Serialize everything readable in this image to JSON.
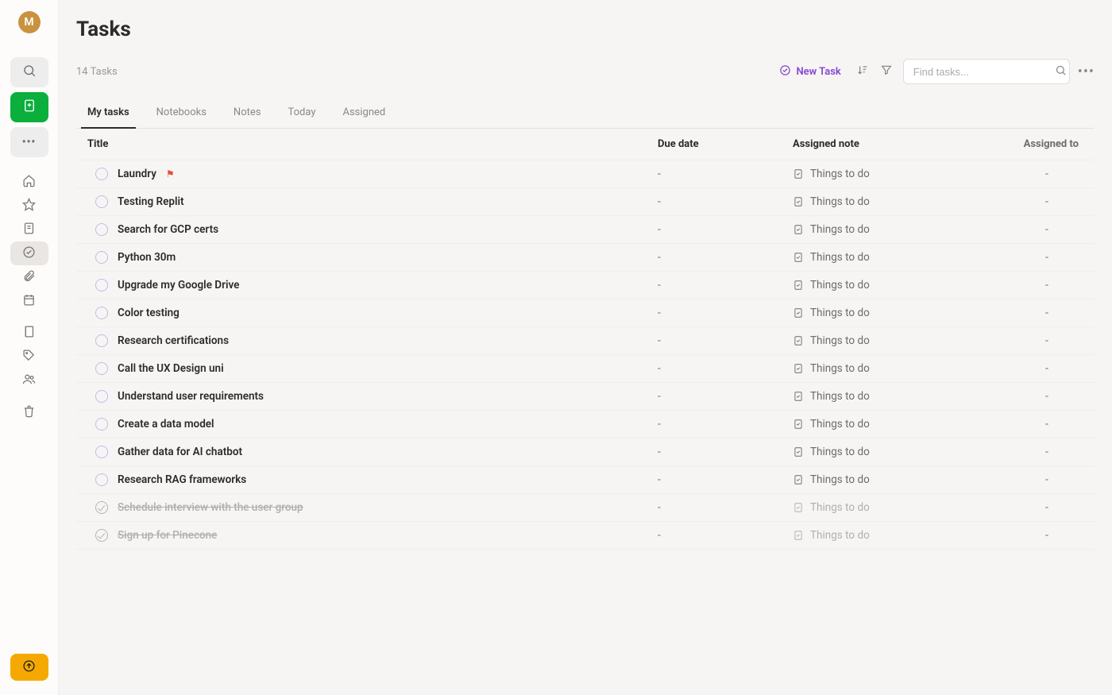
{
  "sidebar": {
    "avatar_letter": "M"
  },
  "header": {
    "title": "Tasks",
    "count_text": "14 Tasks",
    "new_task_label": "New Task",
    "search_placeholder": "Find tasks..."
  },
  "tabs": [
    {
      "id": "my-tasks",
      "label": "My tasks",
      "active": true
    },
    {
      "id": "notebooks",
      "label": "Notebooks",
      "active": false
    },
    {
      "id": "notes",
      "label": "Notes",
      "active": false
    },
    {
      "id": "today",
      "label": "Today",
      "active": false
    },
    {
      "id": "assigned",
      "label": "Assigned",
      "active": false
    }
  ],
  "columns": {
    "title": "Title",
    "due": "Due date",
    "note": "Assigned note",
    "assigned_to": "Assigned to"
  },
  "tasks": [
    {
      "title": "Laundry",
      "flagged": true,
      "due": "-",
      "note": "Things to do",
      "assigned": "-",
      "completed": false
    },
    {
      "title": "Testing Replit",
      "flagged": false,
      "due": "-",
      "note": "Things to do",
      "assigned": "-",
      "completed": false
    },
    {
      "title": "Search for GCP certs",
      "flagged": false,
      "due": "-",
      "note": "Things to do",
      "assigned": "-",
      "completed": false
    },
    {
      "title": "Python 30m",
      "flagged": false,
      "due": "-",
      "note": "Things to do",
      "assigned": "-",
      "completed": false
    },
    {
      "title": "Upgrade my Google Drive",
      "flagged": false,
      "due": "-",
      "note": "Things to do",
      "assigned": "-",
      "completed": false
    },
    {
      "title": "Color testing",
      "flagged": false,
      "due": "-",
      "note": "Things to do",
      "assigned": "-",
      "completed": false
    },
    {
      "title": "Research certifications",
      "flagged": false,
      "due": "-",
      "note": "Things to do",
      "assigned": "-",
      "completed": false
    },
    {
      "title": "Call the UX Design uni",
      "flagged": false,
      "due": "-",
      "note": "Things to do",
      "assigned": "-",
      "completed": false
    },
    {
      "title": "Understand user requirements",
      "flagged": false,
      "due": "-",
      "note": "Things to do",
      "assigned": "-",
      "completed": false
    },
    {
      "title": "Create a data model",
      "flagged": false,
      "due": "-",
      "note": "Things to do",
      "assigned": "-",
      "completed": false
    },
    {
      "title": "Gather data for AI chatbot",
      "flagged": false,
      "due": "-",
      "note": "Things to do",
      "assigned": "-",
      "completed": false
    },
    {
      "title": "Research RAG frameworks",
      "flagged": false,
      "due": "-",
      "note": "Things to do",
      "assigned": "-",
      "completed": false
    },
    {
      "title": "Schedule interview with the user group",
      "flagged": false,
      "due": "-",
      "note": "Things to do",
      "assigned": "-",
      "completed": true
    },
    {
      "title": "Sign up for Pinecone",
      "flagged": false,
      "due": "-",
      "note": "Things to do",
      "assigned": "-",
      "completed": true
    }
  ]
}
